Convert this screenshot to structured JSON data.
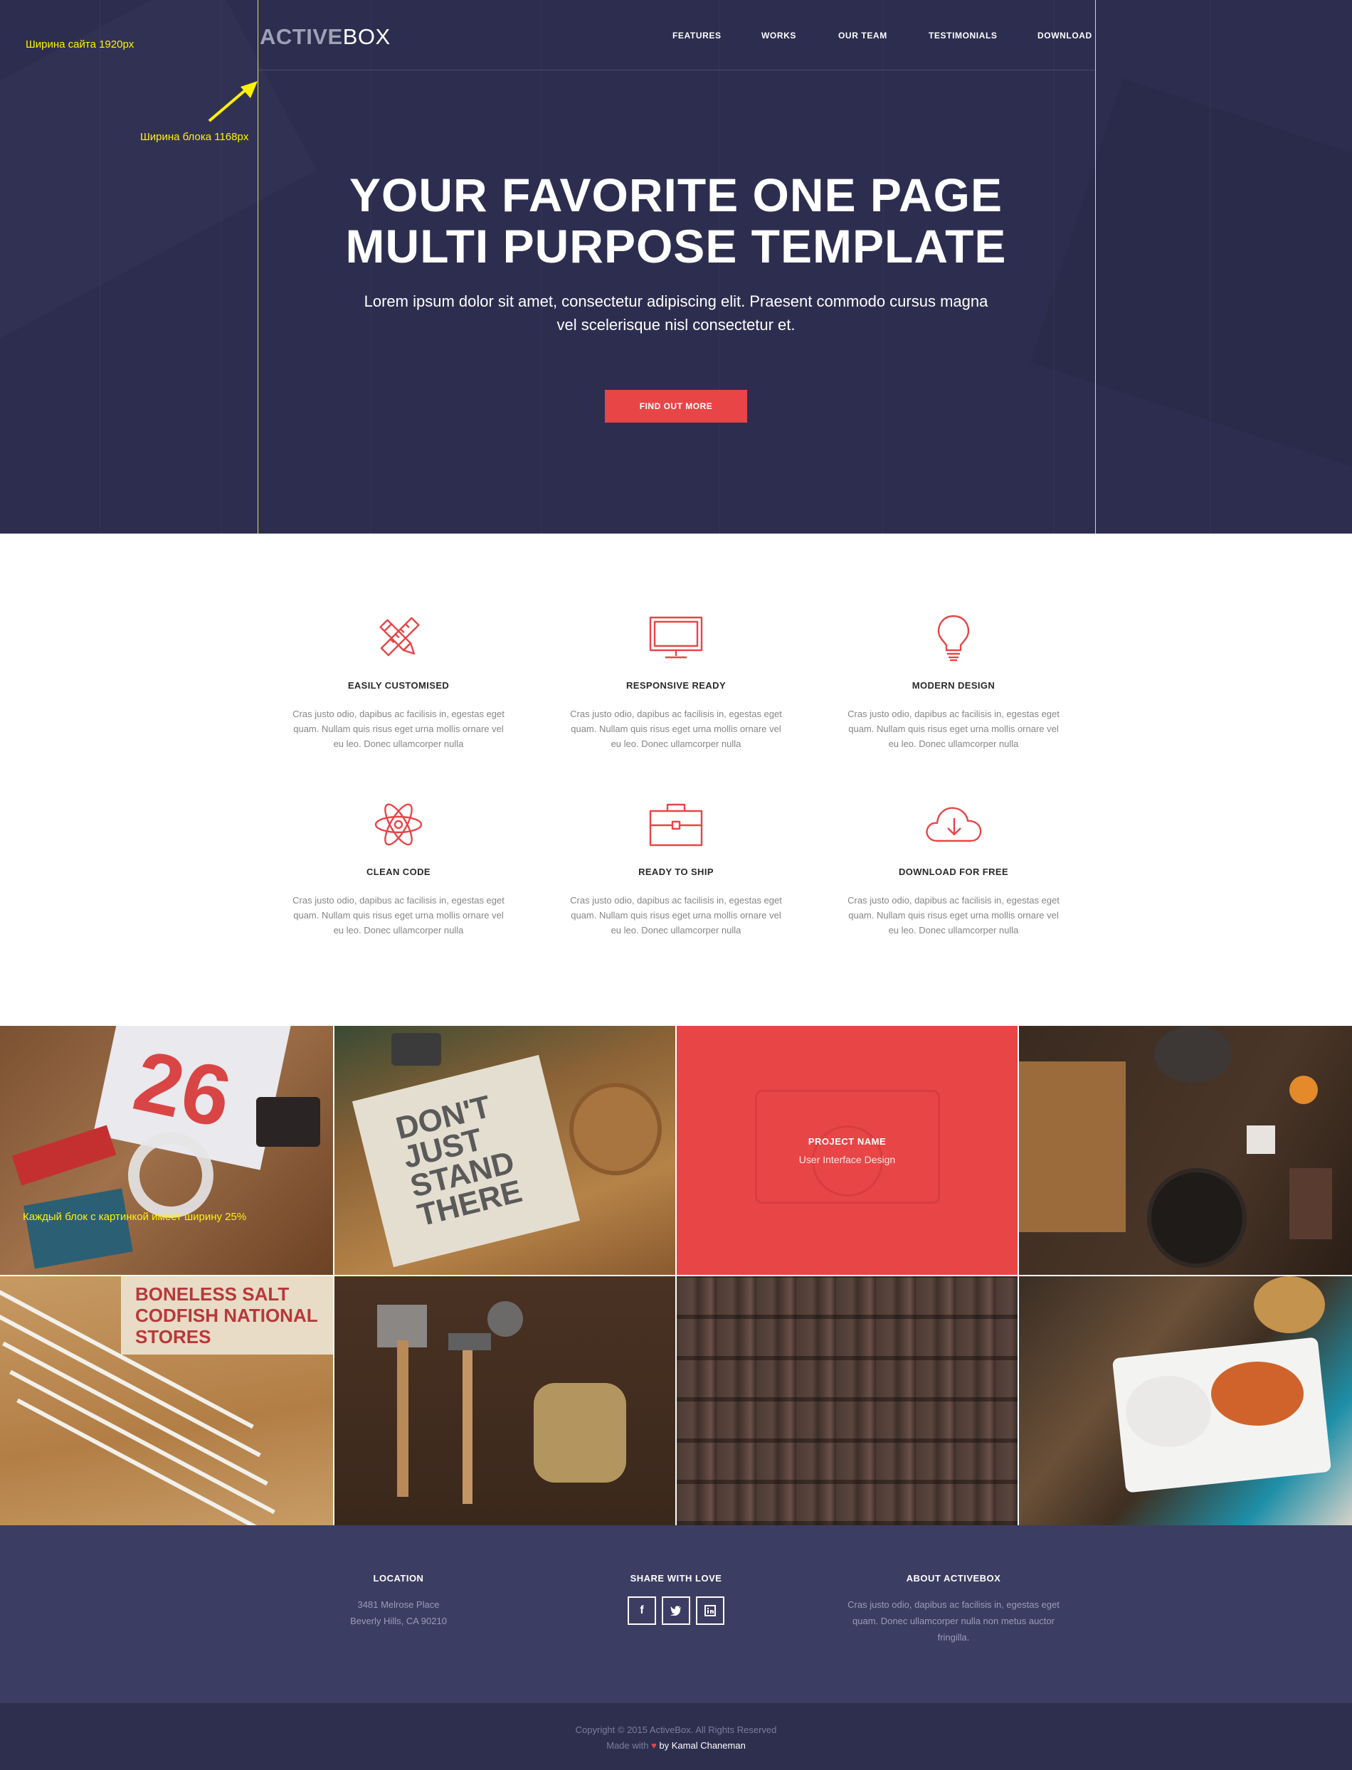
{
  "colors": {
    "hero_bg": "#2d2e4f",
    "accent": "#e84547",
    "footer_bg": "#3c3d62",
    "bottom_bg": "#2e2f4f",
    "annotation": "#fff200"
  },
  "header": {
    "logo_bold": "ACTIVE",
    "logo_light": "BOX",
    "nav": [
      "FEATURES",
      "WORKS",
      "OUR TEAM",
      "TESTIMONIALS",
      "DOWNLOAD"
    ]
  },
  "hero": {
    "title_line1": "YOUR FAVORITE ONE PAGE",
    "title_line2": "MULTI PURPOSE TEMPLATE",
    "lead_line1": "Lorem ipsum dolor sit amet, consectetur adipiscing elit. Praesent commodo cursus magna",
    "lead_line2": "vel scelerisque nisl consectetur et.",
    "cta": "FIND OUT MORE"
  },
  "annotations": {
    "site_width": "Ширина сайта 1920px",
    "block_width": "Ширина блока 1168px",
    "tile_width": "Каждый блок с картинкой имеет ширину 25%"
  },
  "features": [
    {
      "icon": "pencil-ruler-icon",
      "title": "EASILY CUSTOMISED",
      "text": "Cras justo odio, dapibus ac facilisis in, egestas eget quam. Nullam quis risus eget urna mollis ornare vel eu leo. Donec ullamcorper nulla"
    },
    {
      "icon": "monitor-icon",
      "title": "RESPONSIVE READY",
      "text": "Cras justo odio, dapibus ac facilisis in, egestas eget quam. Nullam quis risus eget urna mollis ornare vel eu leo. Donec ullamcorper nulla"
    },
    {
      "icon": "lightbulb-icon",
      "title": "MODERN DESIGN",
      "text": "Cras justo odio, dapibus ac facilisis in, egestas eget quam. Nullam quis risus eget urna mollis ornare vel eu leo. Donec ullamcorper nulla"
    },
    {
      "icon": "atom-icon",
      "title": "CLEAN CODE",
      "text": "Cras justo odio, dapibus ac facilisis in, egestas eget quam. Nullam quis risus eget urna mollis ornare vel eu leo. Donec ullamcorper nulla"
    },
    {
      "icon": "briefcase-icon",
      "title": "READY TO SHIP",
      "text": "Cras justo odio, dapibus ac facilisis in, egestas eget quam. Nullam quis risus eget urna mollis ornare vel eu leo. Donec ullamcorper nulla"
    },
    {
      "icon": "cloud-download-icon",
      "title": "DOWNLOAD FOR FREE",
      "text": "Cras justo odio, dapibus ac facilisis in, egestas eget quam. Nullam quis risus eget urna mollis ornare vel eu leo. Donec ullamcorper nulla"
    }
  ],
  "works": {
    "tiles": [
      {
        "image": "desk-flatlay-photo",
        "lettering": "26"
      },
      {
        "image": "notebook-coasters-photo",
        "lettering": "DON'T JUST STAND THERE"
      },
      {
        "image": "camera-photo-hover",
        "project_name": "PROJECT NAME",
        "project_type": "User Interface Design"
      },
      {
        "image": "kitchen-table-photo"
      },
      {
        "image": "paint-brushes-photo",
        "lettering": "BONELESS SALT CODFISH NATIONAL STORES"
      },
      {
        "image": "hand-tools-photo"
      },
      {
        "image": "letterpress-type-photo"
      },
      {
        "image": "food-plate-photo"
      }
    ]
  },
  "footer": {
    "location": {
      "title": "LOCATION",
      "line1": "3481 Melrose Place",
      "line2": "Beverly Hills, CA 90210"
    },
    "share": {
      "title": "SHARE WITH LOVE",
      "icons": [
        "facebook-icon",
        "twitter-icon",
        "linkedin-icon"
      ]
    },
    "about": {
      "title": "ABOUT ACTIVEBOX",
      "line1": "Cras justo odio, dapibus ac facilisis in, egestas eget",
      "line2": "quam. Donec ullamcorper nulla non metus auctor",
      "line3": "fringilla."
    }
  },
  "copyright": {
    "line1": "Copyright © 2015 ActiveBox. All Rights Reserved",
    "made_with": "Made with",
    "by": "by Kamal Chaneman"
  }
}
